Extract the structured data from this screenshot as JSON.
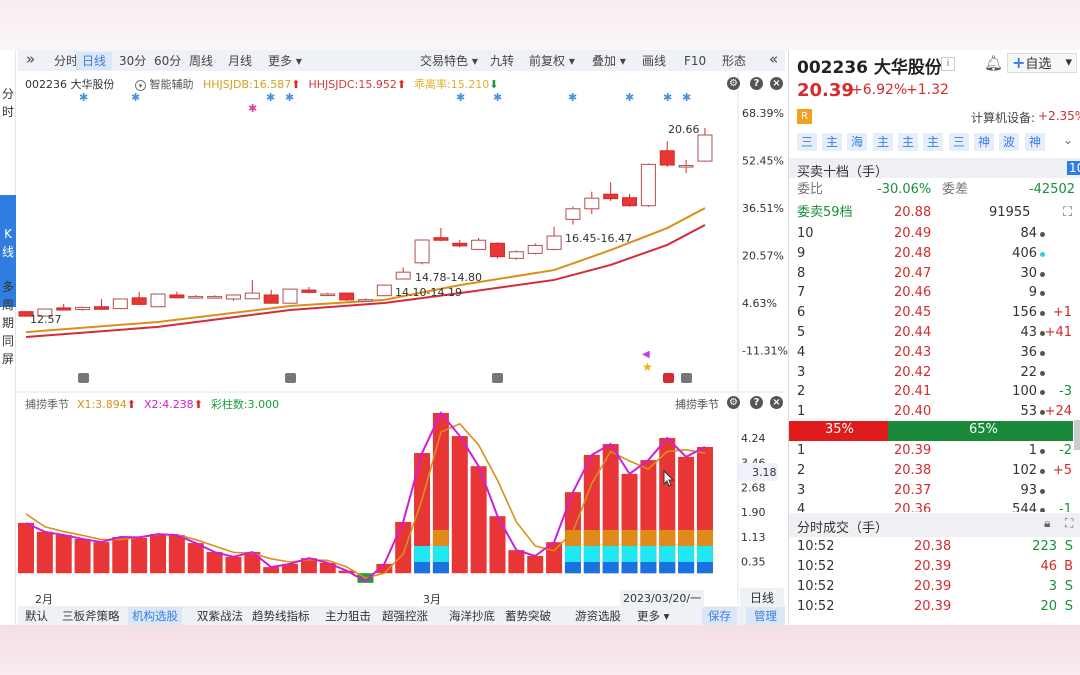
{
  "toolbar": {
    "left_items": [
      {
        "label": "分时"
      },
      {
        "label": "日线",
        "active": true
      },
      {
        "label": "30分"
      },
      {
        "label": "60分"
      },
      {
        "label": "周线"
      },
      {
        "label": "月线"
      },
      {
        "label": "更多 ▾"
      }
    ],
    "right_items": [
      {
        "label": "交易特色 ▾"
      },
      {
        "label": "九转"
      },
      {
        "label": "前复权 ▾"
      },
      {
        "label": "叠加 ▾"
      },
      {
        "label": "画线"
      },
      {
        "label": "F10"
      },
      {
        "label": "形态"
      }
    ],
    "expand": "»",
    "collapse": "«"
  },
  "left_tabs": [
    {
      "label": "分\n时"
    },
    {
      "label": "K\n线",
      "active": true
    },
    {
      "label": "多\n周\n期\n同\n屏"
    }
  ],
  "main_chart": {
    "stock": "002236 大华股份",
    "assist": "智能辅助",
    "indicators": [
      {
        "label": "HHJSJDB:16.587",
        "color": "#d4a020",
        "arrow": "up"
      },
      {
        "label": "HHJSJDC:15.952",
        "color": "#d43a3a",
        "arrow": "up"
      },
      {
        "label": "乖离率:15.210",
        "color": "#e0b030",
        "arrow": "down"
      }
    ],
    "percent_axis": [
      "68.39%",
      "52.45%",
      "36.51%",
      "20.57%",
      "4.63%",
      "-11.31%"
    ],
    "annotations": [
      "12.57",
      "14.10-14.19",
      "14.78-14.80",
      "16.45-16.47",
      "20.66"
    ]
  },
  "chart_data": [
    {
      "type": "candlestick",
      "price_range": [
        12.57,
        20.66
      ],
      "candles": [
        [
          12.84,
          12.65,
          12.86,
          12.63
        ],
        [
          12.65,
          12.95,
          12.97,
          12.63
        ],
        [
          13.0,
          12.91,
          13.17,
          12.89
        ],
        [
          12.93,
          13.02,
          13.05,
          12.88
        ],
        [
          13.05,
          12.94,
          13.38,
          12.92
        ],
        [
          12.97,
          13.38,
          13.4,
          12.95
        ],
        [
          13.43,
          13.15,
          13.69,
          13.13
        ],
        [
          13.05,
          13.59,
          13.61,
          13.03
        ],
        [
          13.55,
          13.43,
          13.69,
          13.41
        ],
        [
          13.47,
          13.48,
          13.55,
          13.42
        ],
        [
          13.47,
          13.48,
          13.54,
          13.42
        ],
        [
          13.38,
          13.55,
          13.58,
          13.3
        ],
        [
          13.39,
          13.63,
          14.19,
          13.37
        ],
        [
          13.55,
          13.2,
          13.76,
          13.18
        ],
        [
          13.2,
          13.8,
          13.82,
          13.18
        ],
        [
          13.76,
          13.66,
          13.89,
          13.62
        ],
        [
          13.58,
          13.59,
          13.65,
          13.54
        ],
        [
          13.63,
          13.34,
          13.65,
          13.3
        ],
        [
          13.34,
          13.35,
          13.4,
          13.3
        ],
        [
          13.52,
          13.97,
          13.99,
          13.5
        ],
        [
          14.23,
          14.52,
          14.72,
          14.21
        ],
        [
          14.92,
          15.89,
          15.92,
          14.85
        ],
        [
          15.99,
          15.88,
          16.4,
          15.84
        ],
        [
          15.75,
          15.64,
          15.9,
          15.58
        ],
        [
          15.49,
          15.88,
          15.98,
          15.47
        ],
        [
          15.75,
          15.18,
          15.8,
          15.1
        ],
        [
          15.11,
          15.39,
          15.45,
          15.05
        ],
        [
          15.32,
          15.66,
          15.75,
          15.28
        ],
        [
          15.49,
          16.06,
          16.45,
          15.45
        ],
        [
          16.77,
          17.22,
          17.32,
          16.55
        ],
        [
          17.22,
          17.67,
          17.95,
          17.0
        ],
        [
          17.84,
          17.65,
          18.36,
          17.55
        ],
        [
          17.69,
          17.35,
          17.85,
          17.3
        ],
        [
          17.35,
          19.11,
          19.15,
          17.3
        ],
        [
          19.69,
          19.08,
          20.1,
          19.0
        ],
        [
          19.05,
          19.06,
          19.3,
          18.74
        ],
        [
          19.25,
          20.36,
          20.66,
          19.22
        ]
      ],
      "ma": [
        {
          "color": "#d9901a",
          "points": [
            [
              0,
              11.97
            ],
            [
              7,
              12.4
            ],
            [
              14,
              13.08
            ],
            [
              19,
              13.34
            ],
            [
              23,
              13.97
            ],
            [
              28,
              14.61
            ],
            [
              31,
              15.46
            ],
            [
              34,
              16.4
            ],
            [
              36,
              17.25
            ]
          ]
        },
        {
          "color": "#d42b3a",
          "points": [
            [
              0,
              11.76
            ],
            [
              7,
              12.19
            ],
            [
              14,
              12.91
            ],
            [
              19,
              13.21
            ],
            [
              23,
              13.63
            ],
            [
              28,
              14.19
            ],
            [
              31,
              14.83
            ],
            [
              34,
              15.68
            ],
            [
              36,
              16.53
            ]
          ]
        }
      ]
    },
    {
      "type": "bar+line",
      "title": "捕捞季节",
      "legend": [
        {
          "label": "X1:3.894",
          "color": "#d9901a"
        },
        {
          "label": "X2:4.238",
          "color": "#d020d0"
        },
        {
          "label": "彩柱数:3.000",
          "color": "#1aa03a"
        }
      ],
      "y_ticks": [
        "4.24",
        "3.46",
        "2.68",
        "1.90",
        "1.13",
        "0.35"
      ],
      "cursor_value": "3.18",
      "bars": [
        1.57,
        1.29,
        1.19,
        1.07,
        0.97,
        1.13,
        1.1,
        1.22,
        1.19,
        0.94,
        0.66,
        0.51,
        0.66,
        0.19,
        0.29,
        0.47,
        0.32,
        0.08,
        -0.3,
        0.29,
        1.6,
        3.75,
        5.0,
        4.28,
        3.34,
        1.78,
        0.72,
        0.54,
        0.97,
        2.53,
        3.69,
        4.03,
        3.1,
        3.53,
        4.22,
        3.63,
        3.94
      ],
      "color_levels": [
        0,
        0,
        0,
        0,
        0,
        0,
        0,
        0,
        0,
        0,
        0,
        0,
        0,
        0,
        0,
        0,
        0,
        0,
        0,
        0,
        0,
        2,
        3,
        0,
        0,
        0,
        0,
        0,
        0,
        3,
        3,
        3,
        3,
        3,
        3,
        3,
        3
      ],
      "x1": [
        1.85,
        1.45,
        1.3,
        1.18,
        1.05,
        1.05,
        1.12,
        1.2,
        1.2,
        1.05,
        0.85,
        0.65,
        0.62,
        0.45,
        0.35,
        0.42,
        0.4,
        0.2,
        -0.15,
        0.0,
        0.6,
        2.3,
        4.4,
        4.66,
        4.0,
        2.9,
        1.6,
        0.85,
        0.7,
        1.3,
        2.8,
        3.8,
        3.5,
        3.25,
        3.8,
        3.85,
        3.75
      ],
      "x2": [
        1.57,
        1.29,
        1.19,
        1.07,
        0.97,
        1.13,
        1.12,
        1.22,
        1.19,
        0.94,
        0.66,
        0.51,
        0.66,
        0.19,
        0.29,
        0.47,
        0.32,
        0.08,
        -0.25,
        0.29,
        1.6,
        3.75,
        5.0,
        4.28,
        3.34,
        1.78,
        0.72,
        0.54,
        0.97,
        2.53,
        3.69,
        4.03,
        3.1,
        3.53,
        4.22,
        3.63,
        3.94
      ]
    }
  ],
  "date_axis": {
    "labels": [
      "2月",
      "3月"
    ],
    "current": "2023/03/20/一",
    "period": "日线"
  },
  "bottom_tabs": [
    {
      "label": "默认"
    },
    {
      "label": "三板斧策略"
    },
    {
      "label": "机构选股",
      "active": true
    },
    {
      "label": "双紫战法"
    },
    {
      "label": "趋势线指标"
    },
    {
      "label": "主力狙击"
    },
    {
      "label": "超强控涨"
    },
    {
      "label": "海洋抄底"
    },
    {
      "label": "蓄势突破"
    },
    {
      "label": "游资选股"
    },
    {
      "label": "更多 ▾"
    }
  ],
  "bottom_actions": {
    "save": "保存",
    "manage": "管理"
  },
  "quote": {
    "code_name": "002236 大华股份",
    "badge": "i",
    "price": "20.39",
    "pct": "+6.92%",
    "chg": "+1.32",
    "r_badge": "R",
    "industry": "计算机设备:",
    "industry_pct": "+2.35%",
    "watch": "自选",
    "add": "+"
  },
  "strategy_buttons": [
    "三",
    "主",
    "海",
    "主",
    "主",
    "主",
    "三",
    "神",
    "波",
    "神"
  ],
  "orderbook": {
    "title": "买卖十档（手）",
    "level_badge": "10",
    "ratio_label": "委比",
    "ratio": "-30.06%",
    "diff_label": "委差",
    "diff": "-42502",
    "ask_total_label": "委卖59档",
    "ask_total_price": "20.88",
    "ask_total_vol": "91955",
    "asks": [
      {
        "n": "10",
        "p": "20.49",
        "v": "84",
        "c": ""
      },
      {
        "n": "9",
        "p": "20.48",
        "v": "406",
        "c": "",
        "dot": "#30d0d8"
      },
      {
        "n": "8",
        "p": "20.47",
        "v": "30",
        "c": ""
      },
      {
        "n": "7",
        "p": "20.46",
        "v": "9",
        "c": ""
      },
      {
        "n": "6",
        "p": "20.45",
        "v": "156",
        "c": "+1"
      },
      {
        "n": "5",
        "p": "20.44",
        "v": "43",
        "c": "+41"
      },
      {
        "n": "4",
        "p": "20.43",
        "v": "36",
        "c": ""
      },
      {
        "n": "3",
        "p": "20.42",
        "v": "22",
        "c": ""
      },
      {
        "n": "2",
        "p": "20.41",
        "v": "100",
        "c": "-3"
      },
      {
        "n": "1",
        "p": "20.40",
        "v": "53",
        "c": "+24"
      }
    ],
    "buy_pct": "35%",
    "sell_pct": "65%",
    "buy_fraction": 0.35,
    "bids": [
      {
        "n": "1",
        "p": "20.39",
        "v": "1",
        "c": "-2"
      },
      {
        "n": "2",
        "p": "20.38",
        "v": "102",
        "c": "+5"
      },
      {
        "n": "3",
        "p": "20.37",
        "v": "93",
        "c": ""
      },
      {
        "n": "4",
        "p": "20.36",
        "v": "544",
        "c": "-1"
      }
    ]
  },
  "trades": {
    "title": "分时成交（手）",
    "rows": [
      {
        "t": "10:52",
        "p": "20.38",
        "v": "223",
        "s": "S"
      },
      {
        "t": "10:52",
        "p": "20.39",
        "v": "46",
        "s": "B"
      },
      {
        "t": "10:52",
        "p": "20.39",
        "v": "3",
        "s": "S"
      },
      {
        "t": "10:52",
        "p": "20.39",
        "v": "20",
        "s": "S"
      }
    ]
  }
}
